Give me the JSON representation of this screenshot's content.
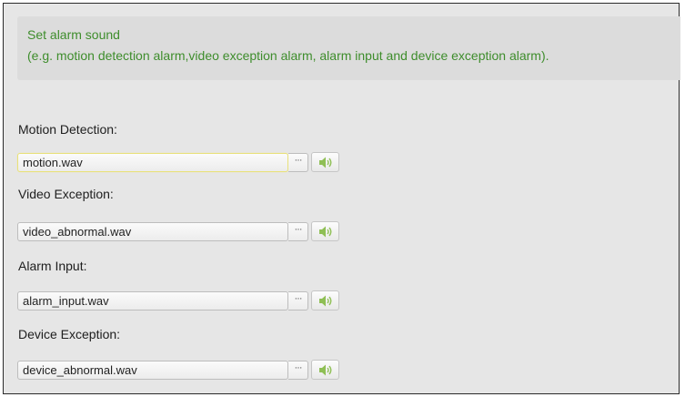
{
  "tip": {
    "line1": "Set alarm sound",
    "line2": "(e.g. motion detection alarm,video exception alarm, alarm input and device exception alarm)."
  },
  "fields": [
    {
      "label": "Motion Detection:",
      "value": "motion.wav",
      "browse": "···"
    },
    {
      "label": "Video Exception:",
      "value": "video_abnormal.wav",
      "browse": "···"
    },
    {
      "label": "Alarm Input:",
      "value": "alarm_input.wav",
      "browse": "···"
    },
    {
      "label": "Device Exception:",
      "value": "device_abnormal.wav",
      "browse": "···"
    }
  ],
  "colors": {
    "tip_text": "#3e8d2c",
    "speaker_icon": "#8fbf55"
  },
  "icons": {
    "sound_test": "speaker-icon"
  }
}
